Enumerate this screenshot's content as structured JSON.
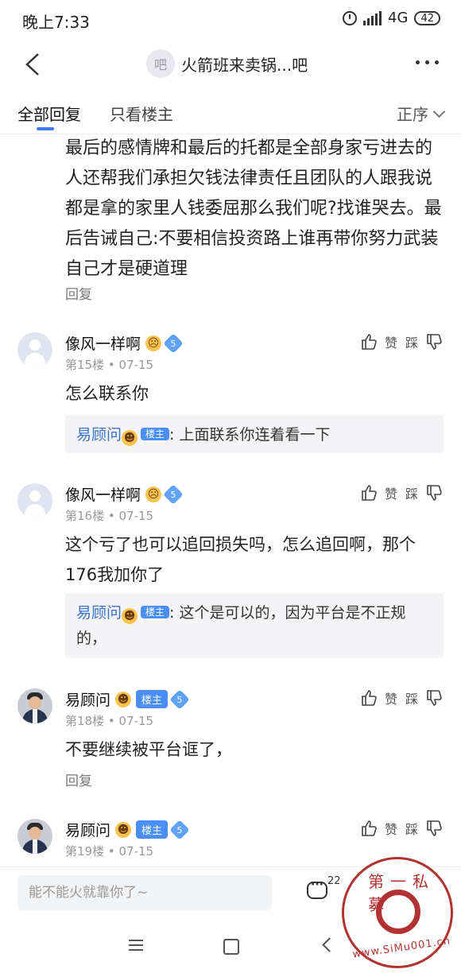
{
  "status": {
    "time": "晚上7:33",
    "network": "4G",
    "battery": "42"
  },
  "header": {
    "forum_avatar_text": "吧",
    "title": "火箭班来卖锅...吧"
  },
  "tabs": [
    {
      "label": "全部回复"
    },
    {
      "label": "只看楼主"
    }
  ],
  "sort": {
    "label": "正序"
  },
  "previous_post": {
    "text": "最后的感情牌和最后的托都是全部身家亏进去的人还帮我们承担欠钱法律责任且团队的人跟我说都是拿的家里人钱委屈那么我们呢?找谁哭去。最后告诫自己:不要相信投资路上谁再带你努力武装自己才是硬道理",
    "reply_label": "回复"
  },
  "action_labels": {
    "like": "赞",
    "dislike": "踩"
  },
  "comments": [
    {
      "username": "像风一样啊",
      "emoji": "sad-face",
      "level": "5",
      "floor": "第15楼",
      "date": "07-15",
      "text": "怎么联系你",
      "reply": {
        "author": "易顾问",
        "badge": "楼主",
        "text": ": 上面联系你连着看一下"
      }
    },
    {
      "username": "像风一样啊",
      "emoji": "sad-face",
      "level": "5",
      "floor": "第16楼",
      "date": "07-15",
      "text": "这个亏了也可以追回损失吗，怎么追回啊，那个176我加你了",
      "reply": {
        "author": "易顾问",
        "badge": "楼主",
        "text": ": 这个是可以的，因为平台是不正规的，"
      }
    },
    {
      "username": "易顾问",
      "emoji": "grin-face",
      "badge": "楼主",
      "level": "5",
      "floor": "第18楼",
      "date": "07-15",
      "text": "不要继续被平台诓了，",
      "reply_label": "回复"
    },
    {
      "username": "易顾问",
      "emoji": "grin-face",
      "badge": "楼主",
      "level": "5",
      "floor": "第19楼",
      "date": "07-15"
    }
  ],
  "reply_bar": {
    "placeholder": "能不能火就靠你了~",
    "comment_count": "22"
  },
  "watermark": {
    "text_top": "第一私募",
    "text_bottom": "www.SiMu001.cn"
  },
  "colors": {
    "accent": "#3c79f2",
    "badge": "#4a8ef7",
    "link_name": "#3b71c8",
    "stamp": "#b23232"
  }
}
